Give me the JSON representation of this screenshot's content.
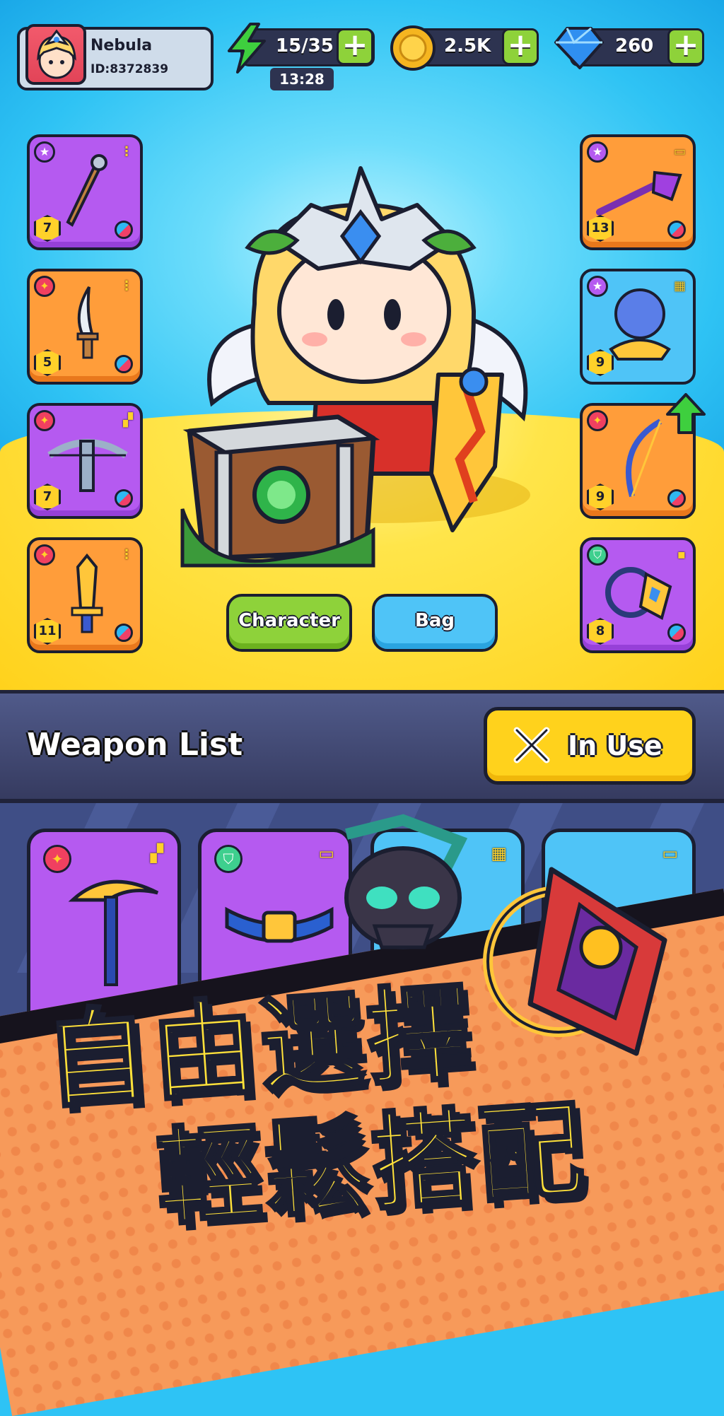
{
  "profile": {
    "name": "Nebula",
    "id_text": "ID:8372839"
  },
  "resources": {
    "energy": {
      "value": "15/35",
      "timer": "13:28"
    },
    "coins": {
      "value": "2.5K"
    },
    "gems": {
      "value": "260"
    }
  },
  "left_slots": [
    {
      "level": "7",
      "color": "purple"
    },
    {
      "level": "5",
      "color": "orange"
    },
    {
      "level": "7",
      "color": "purple"
    },
    {
      "level": "11",
      "color": "orange"
    }
  ],
  "right_slots": [
    {
      "level": "13",
      "color": "orange"
    },
    {
      "level": "9",
      "color": "blue"
    },
    {
      "level": "9",
      "color": "orange"
    },
    {
      "level": "8",
      "color": "purple"
    }
  ],
  "buttons": {
    "character": "Character",
    "bag": "Bag",
    "in_use": "In Use"
  },
  "weapon_list": {
    "title": "Weapon List"
  },
  "promo": {
    "line1": "自由選擇",
    "line2": "輕鬆搭配"
  },
  "colors": {
    "energy": "#3ecf3e",
    "coin": "#f5b520",
    "gem": "#2f8ff0",
    "plus": "#8ed23a",
    "accent_yellow": "#ffd21c"
  }
}
